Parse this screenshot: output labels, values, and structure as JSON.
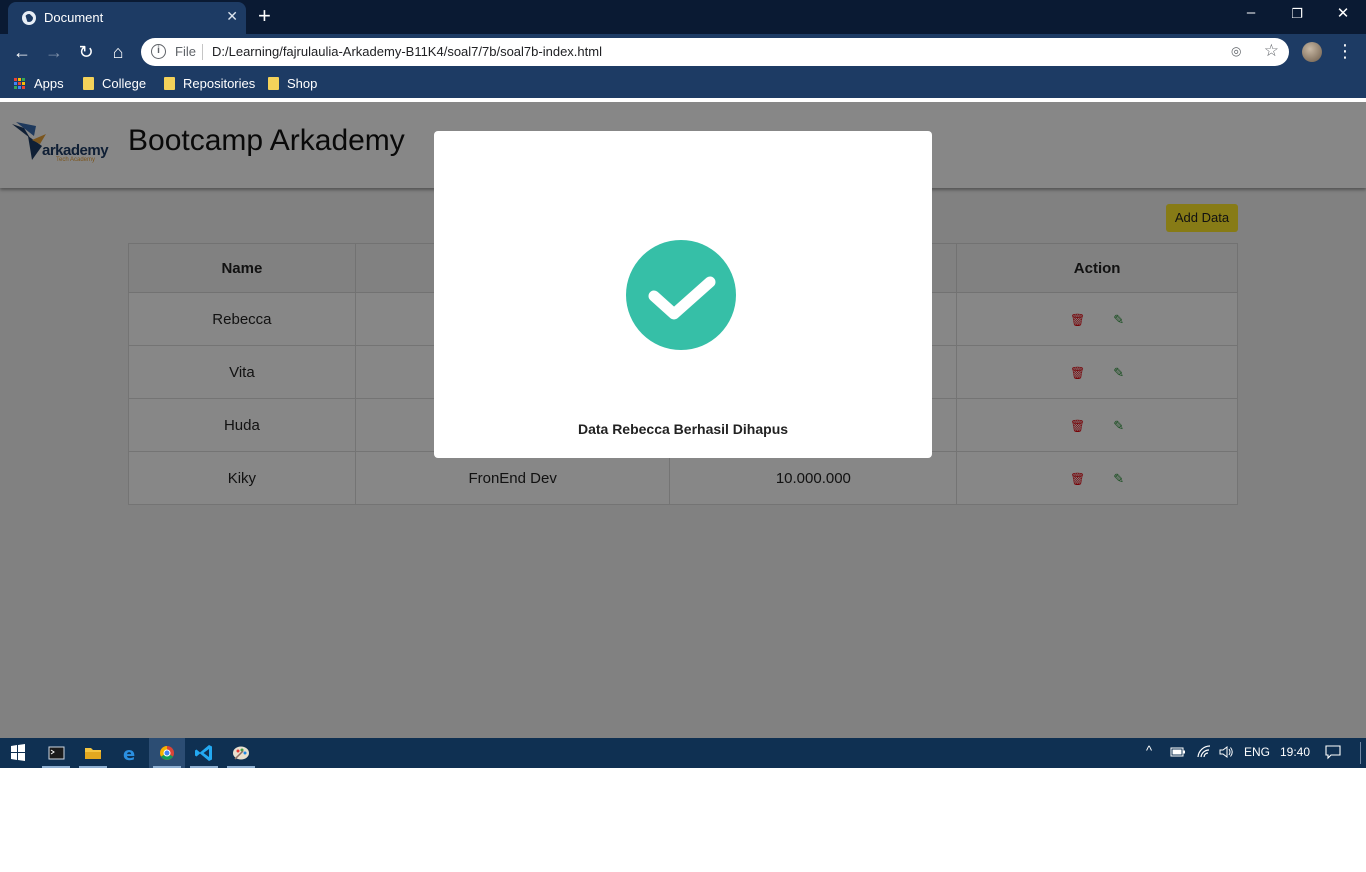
{
  "browser": {
    "tab_title": "Document",
    "tab_close": "✕",
    "new_tab": "+",
    "url_scheme": "File",
    "url": "D:/Learning/fajrulaulia-Arkademy-B11K4/soal7/7b/soal7b-index.html",
    "window_controls": {
      "minimize": "–",
      "restore": "❐",
      "close": "✕"
    }
  },
  "bookmarks": [
    {
      "label": "Apps",
      "icon": "apps-icon"
    },
    {
      "label": "College",
      "icon": "folder-icon"
    },
    {
      "label": "Repositories",
      "icon": "folder-icon"
    },
    {
      "label": "Shop",
      "icon": "folder-icon"
    }
  ],
  "site": {
    "logo_text": "arkademy",
    "logo_sub": "Tech Academy",
    "title": "Bootcamp Arkademy",
    "add_button": "Add Data"
  },
  "table": {
    "headers": [
      "Name",
      "",
      "",
      "Action"
    ],
    "rows": [
      {
        "name": "Rebecca",
        "work": "",
        "salary": ""
      },
      {
        "name": "Vita",
        "work": "",
        "salary": ""
      },
      {
        "name": "Huda",
        "work": "",
        "salary": ""
      },
      {
        "name": "Kiky",
        "work": "FronEnd Dev",
        "salary": "10.000.000"
      }
    ]
  },
  "modal": {
    "message": "Data Rebecca Berhasil Dihapus",
    "icon": "check-icon",
    "accent": "#36bfa7"
  },
  "taskbar": {
    "language": "ENG",
    "time": "19:40"
  },
  "colors": {
    "chrome_dark": "#0a1a33",
    "chrome": "#1d3b64",
    "add_button": "#ffe82a",
    "delete": "#e0000a",
    "edit": "#1f8a2e"
  }
}
